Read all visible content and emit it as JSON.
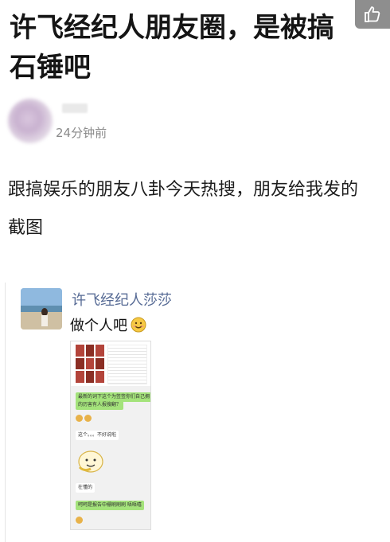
{
  "article": {
    "headline": "许飞经纪人朋友圈，是被搞石锤吧"
  },
  "post": {
    "time": "24分钟前",
    "body": "跟搞娱乐的朋友八卦今天热搜，朋友给我发的截图"
  },
  "moment": {
    "name": "许飞经纪人莎莎",
    "text": "做个人吧"
  },
  "screenshot": {
    "messages": [
      {
        "side": "right",
        "color": "green",
        "text": "最新的词下这个为签签你们自己拥"
      },
      {
        "side": "right",
        "color": "green",
        "text": "的历害有人报搜翻？"
      },
      {
        "side": "left",
        "color": "white",
        "text": "这个。。。不好说啦"
      },
      {
        "side": "left",
        "color": "white",
        "text": "在懂的"
      },
      {
        "side": "right",
        "color": "green",
        "text": "呵呵是报告中栅刷刷刷 唔唔嘻"
      }
    ]
  },
  "icons": {
    "like": "thumbs-up-icon",
    "emoji": "smile-emoji-icon"
  },
  "colors": {
    "link_blue": "#576b95",
    "wechat_green": "#a4e37b"
  }
}
